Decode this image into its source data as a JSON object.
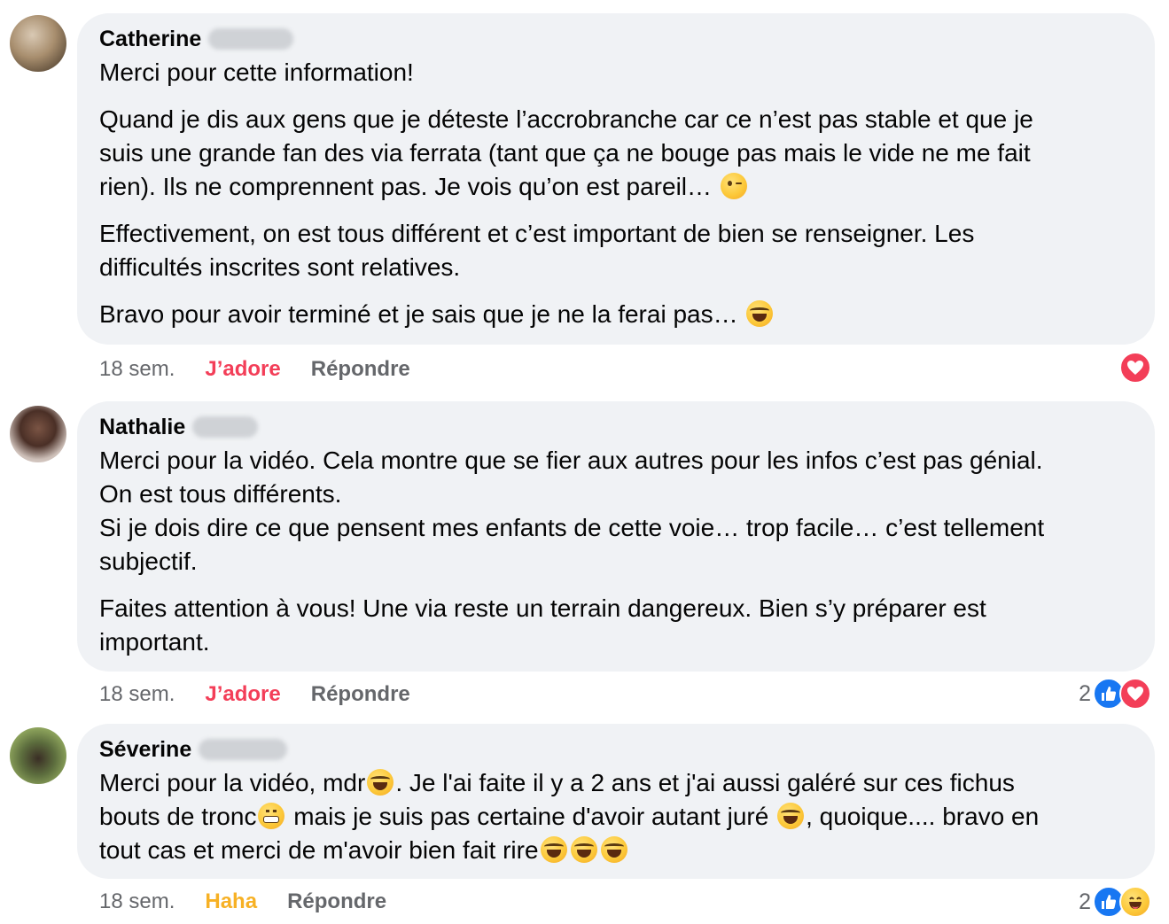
{
  "comments": [
    {
      "author": "Catherine",
      "paragraphs": [
        [
          "Merci pour cette information!"
        ],
        [
          "Quand je dis aux gens que je déteste l’accrobranche car ce n’est pas stable et que je",
          "suis une grande fan des via ferrata (tant que ça ne bouge pas mais le vide ne me fait",
          "rien). Ils ne comprennent pas. Je vois qu’on est pareil…"
        ],
        [
          "Effectivement, on est tous différent et c’est important de bien se renseigner. Les",
          "difficultés inscrites sont relatives."
        ],
        [
          "Bravo pour avoir terminé et je sais que je ne la ferai pas…"
        ]
      ],
      "time": "18 sem.",
      "reaction_label": "J’adore",
      "reply_label": "Répondre",
      "reaction_count": "",
      "reaction_icons": [
        "love-icon"
      ]
    },
    {
      "author": "Nathalie",
      "paragraphs": [
        [
          "Merci pour la vidéo. Cela montre que se fier aux autres pour les infos c’est pas génial.",
          "On est tous différents.",
          "Si je dois dire ce que pensent mes enfants de cette voie… trop facile… c’est tellement",
          "subjectif."
        ],
        [
          "Faites attention à vous! Une via reste un terrain dangereux. Bien s’y préparer est",
          "important."
        ]
      ],
      "time": "18 sem.",
      "reaction_label": "J’adore",
      "reply_label": "Répondre",
      "reaction_count": "2",
      "reaction_icons": [
        "like-icon",
        "love-icon"
      ]
    },
    {
      "author": "Séverine",
      "paragraphs": [
        [
          "Merci pour la vidéo, mdr",
          ". Je l'ai faite il y a 2 ans et j'ai aussi galéré sur ces fichus",
          "bouts de tronc",
          " mais je suis pas certaine d'avoir autant juré ",
          ", quoique.... bravo en",
          "tout cas et merci de m'avoir bien fait rire"
        ]
      ],
      "time": "18 sem.",
      "reaction_label": "Haha",
      "reply_label": "Répondre",
      "reaction_count": "2",
      "reaction_icons": [
        "like-icon",
        "haha-icon"
      ]
    }
  ],
  "colors": {
    "bubble": "#f0f2f5",
    "love": "#f33e58",
    "haha": "#f7b125",
    "like": "#1877f2",
    "meta": "#65676b"
  }
}
